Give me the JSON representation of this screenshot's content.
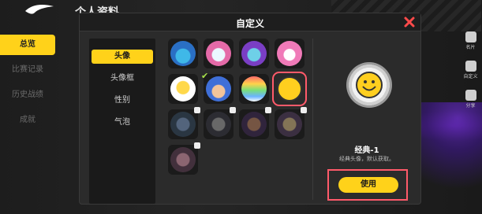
{
  "background": {
    "page_title": "个人资料",
    "left_menu": [
      "总览",
      "比赛记录",
      "历史战绩",
      "成就"
    ],
    "right_side": [
      "名片",
      "自定义",
      "分享"
    ]
  },
  "dialog": {
    "title": "自定义",
    "tabs": [
      "头像",
      "头像框",
      "性别",
      "气泡"
    ],
    "active_tab": "头像",
    "preview": {
      "name": "经典-1",
      "description": "经典头像，默认获取。"
    },
    "use_button": "使用"
  },
  "colors": {
    "accent": "#ffd21a",
    "highlight": "#ff5a6a",
    "dialog_bg": "#2b2b2b"
  }
}
